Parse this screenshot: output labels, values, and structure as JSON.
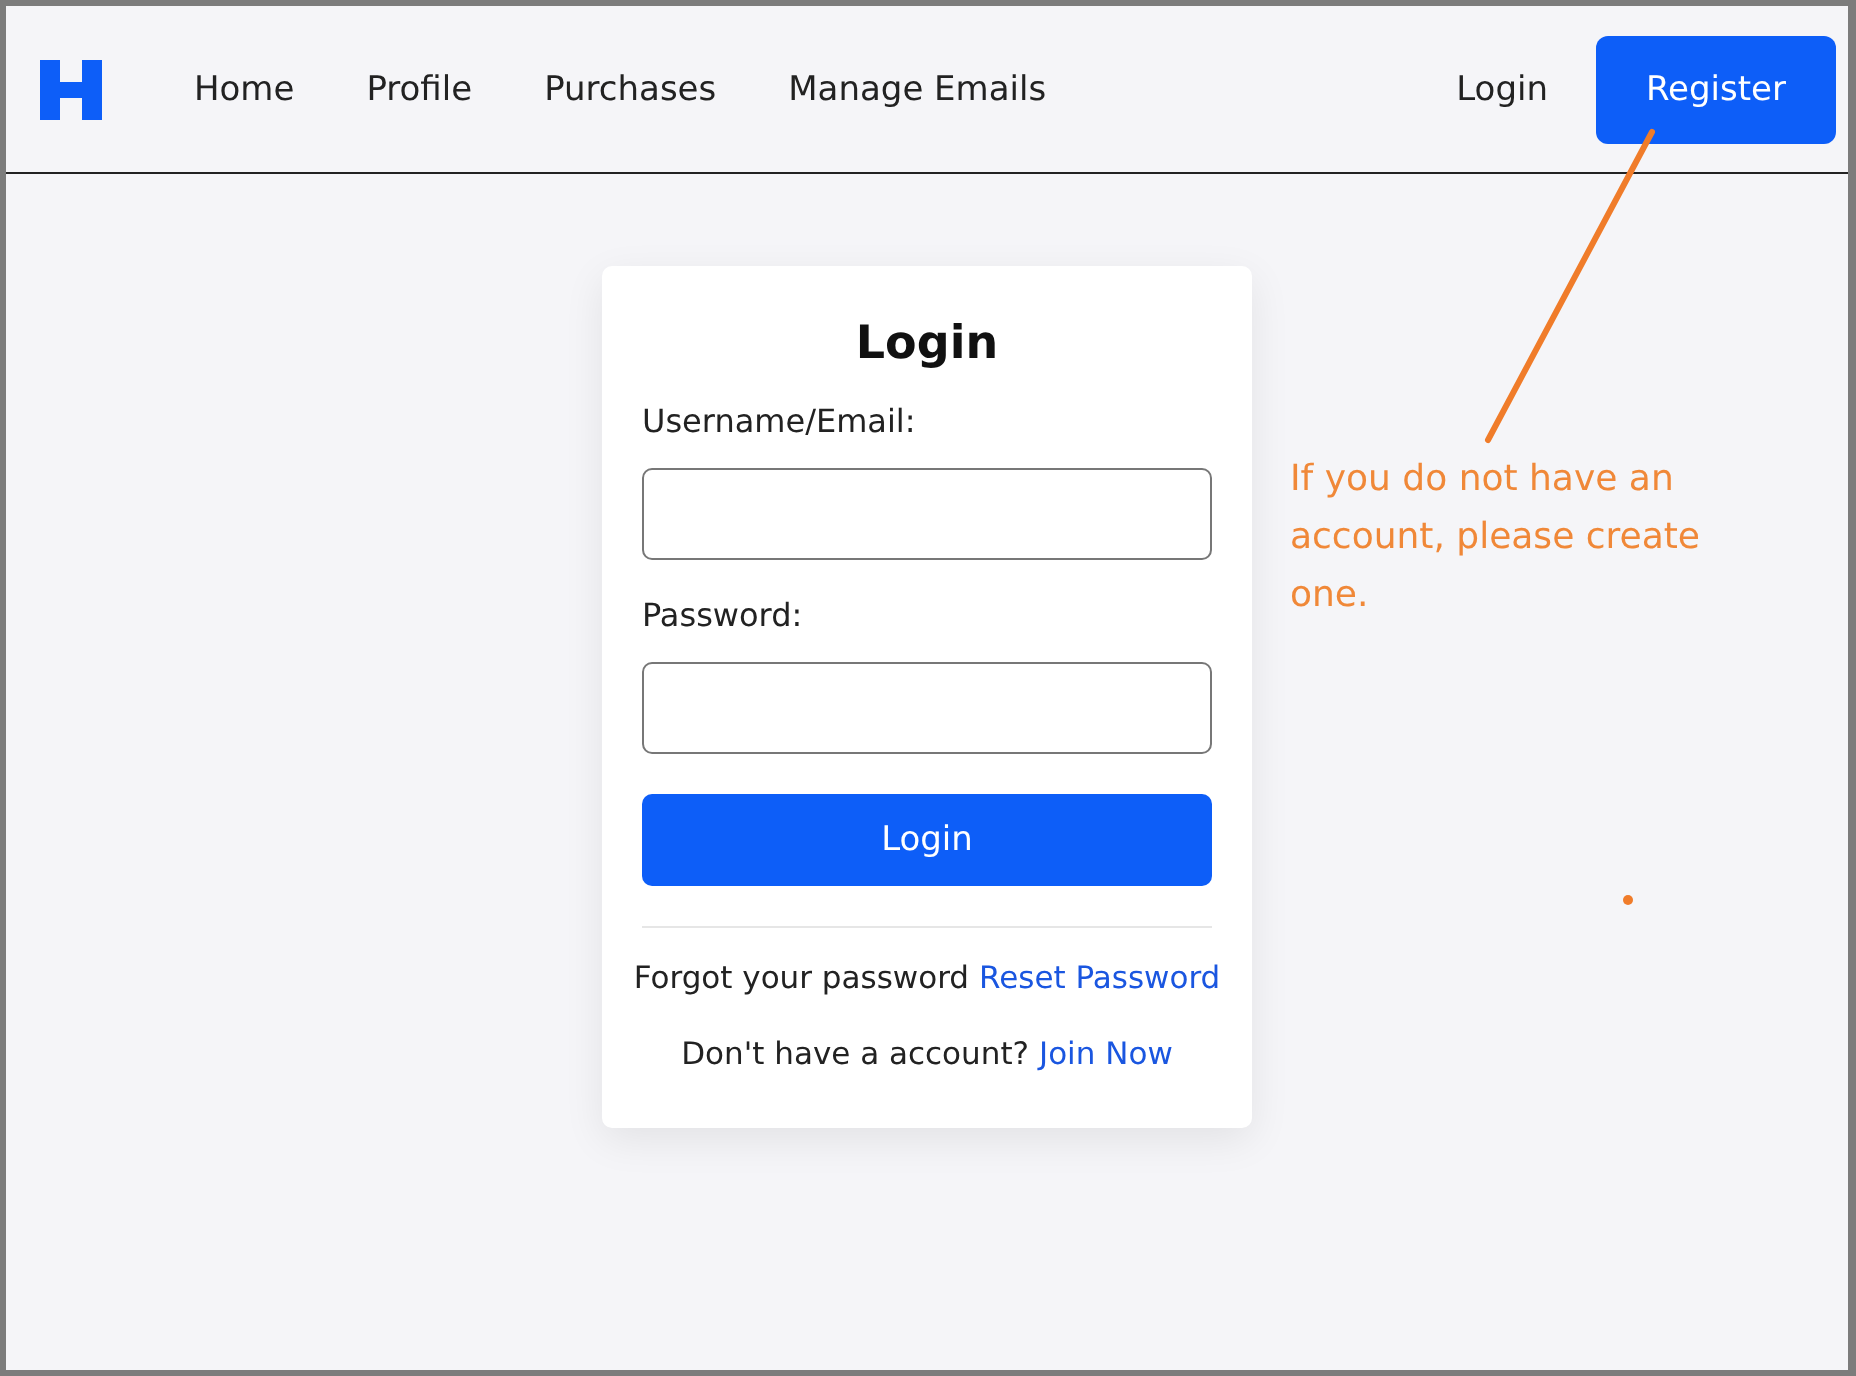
{
  "navbar": {
    "links": [
      {
        "label": "Home"
      },
      {
        "label": "Profile"
      },
      {
        "label": "Purchases"
      },
      {
        "label": "Manage Emails"
      }
    ],
    "login_link": "Login",
    "register_button": "Register"
  },
  "login_card": {
    "title": "Login",
    "fields": [
      {
        "label": "Username/Email:"
      },
      {
        "label": "Password:"
      }
    ],
    "submit_button": "Login",
    "forgot": {
      "text": "Forgot your password",
      "link": "Reset Password"
    },
    "join": {
      "text": "Don't have a account?",
      "link": "Join Now"
    }
  },
  "annotation": {
    "text": "If you do not have an account, please create one."
  }
}
